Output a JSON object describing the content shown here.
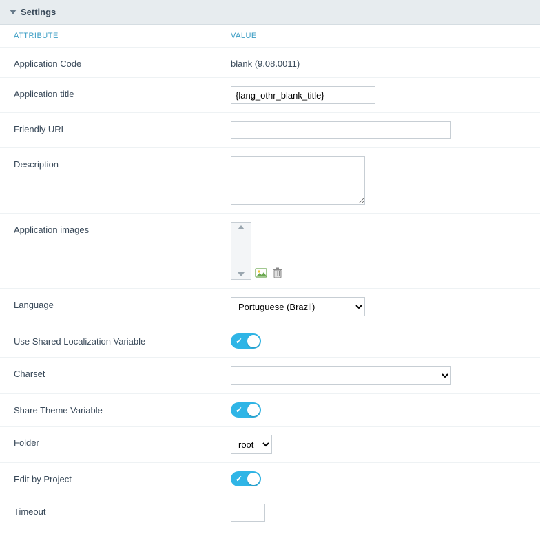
{
  "panel": {
    "title": "Settings"
  },
  "columns": {
    "attribute": "ATTRIBUTE",
    "value": "VALUE"
  },
  "rows": {
    "app_code": {
      "label": "Application Code",
      "value": "blank (9.08.0011)"
    },
    "app_title": {
      "label": "Application title",
      "value": "{lang_othr_blank_title}"
    },
    "friendly_url": {
      "label": "Friendly URL",
      "value": ""
    },
    "description": {
      "label": "Description",
      "value": ""
    },
    "app_images": {
      "label": "Application images"
    },
    "language": {
      "label": "Language",
      "selected": "Portuguese (Brazil)"
    },
    "shared_loc": {
      "label": "Use Shared Localization Variable",
      "on": true
    },
    "charset": {
      "label": "Charset",
      "selected": ""
    },
    "share_theme": {
      "label": "Share Theme Variable",
      "on": true
    },
    "folder": {
      "label": "Folder",
      "selected": "root"
    },
    "edit_by_project": {
      "label": "Edit by Project",
      "on": true
    },
    "timeout": {
      "label": "Timeout",
      "value": ""
    }
  },
  "icons": {
    "add_image": "add-image-icon",
    "delete_image": "trash-icon"
  }
}
